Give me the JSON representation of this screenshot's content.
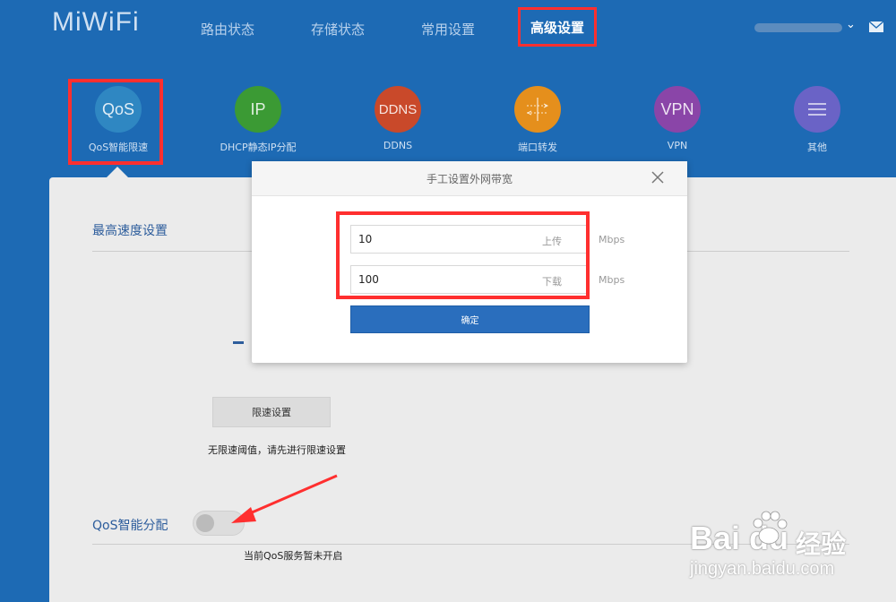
{
  "header": {
    "logo": "MiWiFi",
    "nav": [
      "路由状态",
      "存储状态",
      "常用设置"
    ],
    "nav_active": "高级设置",
    "user_caret": "⌄"
  },
  "features": [
    {
      "icon": "QoS",
      "label": "QoS智能限速",
      "color": "#2f87c2"
    },
    {
      "icon": "IP",
      "label": "DHCP静态IP分配",
      "color": "#3b9a34"
    },
    {
      "icon": "DDNS",
      "label": "DDNS",
      "color": "#c9492a"
    },
    {
      "icon": "port-forward-icon",
      "label": "端口转发",
      "color": "#e58f1c"
    },
    {
      "icon": "VPN",
      "label": "VPN",
      "color": "#8a45a8"
    },
    {
      "icon": "menu-icon",
      "label": "其他",
      "color": "#6a63c6"
    }
  ],
  "panel": {
    "section_title": "最高速度设置",
    "limit_button": "限速设置",
    "limit_tip": "无限速阈值，请先进行限速设置",
    "qos_title": "QoS智能分配",
    "qos_enabled": false,
    "qos_tip": "当前QoS服务暂未开启"
  },
  "modal": {
    "title": "手工设置外网带宽",
    "upload_value": "10",
    "upload_label": "上传",
    "download_value": "100",
    "download_label": "下载",
    "unit": "Mbps",
    "confirm": "确定"
  },
  "watermark": {
    "brand": "Bai  du",
    "jingyan": "经验",
    "url": "jingyan.baidu.com"
  }
}
